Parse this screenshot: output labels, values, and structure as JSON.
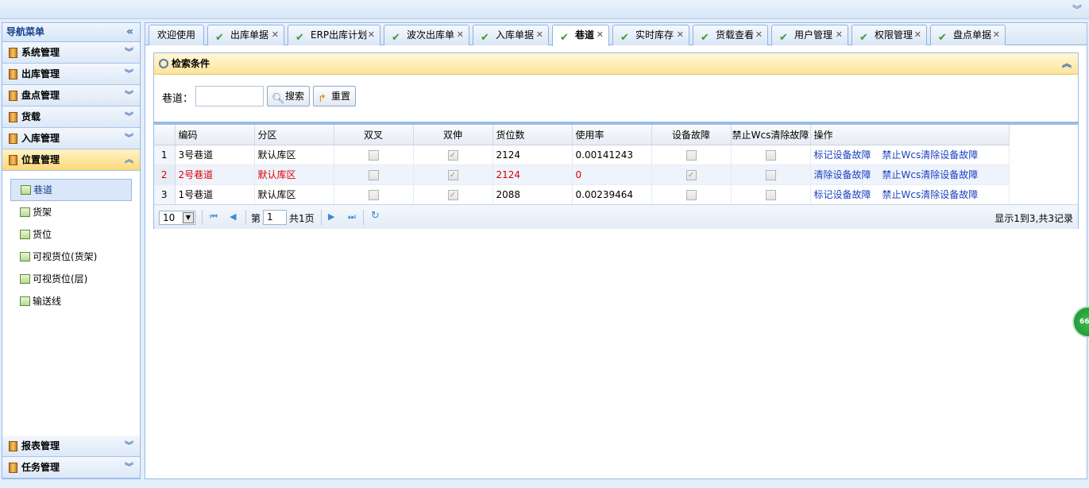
{
  "topbar": {
    "collapse_icon": "chevron-double-down-icon"
  },
  "nav": {
    "title": "导航菜单",
    "groups_top": [
      {
        "label": "系统管理"
      },
      {
        "label": "出库管理"
      },
      {
        "label": "盘点管理"
      },
      {
        "label": "货载"
      },
      {
        "label": "入库管理"
      },
      {
        "label": "位置管理",
        "active": true
      }
    ],
    "sub_items": [
      {
        "label": "巷道",
        "active": true
      },
      {
        "label": "货架"
      },
      {
        "label": "货位"
      },
      {
        "label": "可视货位(货架)"
      },
      {
        "label": "可视货位(层)"
      },
      {
        "label": "输送线"
      }
    ],
    "groups_bottom": [
      {
        "label": "报表管理"
      },
      {
        "label": "任务管理"
      }
    ]
  },
  "tabs": [
    {
      "label": "欢迎使用",
      "closable": false,
      "checked": false
    },
    {
      "label": "出库单据",
      "closable": true,
      "checked": true
    },
    {
      "label": "ERP出库计划",
      "closable": true,
      "checked": true
    },
    {
      "label": "波次出库单",
      "closable": true,
      "checked": true
    },
    {
      "label": "入库单据",
      "closable": true,
      "checked": true
    },
    {
      "label": "巷道",
      "closable": true,
      "checked": true,
      "active": true
    },
    {
      "label": "实时库存",
      "closable": true,
      "checked": true
    },
    {
      "label": "货载查看",
      "closable": true,
      "checked": true
    },
    {
      "label": "用户管理",
      "closable": true,
      "checked": true
    },
    {
      "label": "权限管理",
      "closable": true,
      "checked": true
    },
    {
      "label": "盘点单据",
      "closable": true,
      "checked": true
    }
  ],
  "search": {
    "title": "检索条件",
    "lane_label": "巷道：",
    "lane_value": "",
    "search_label": "搜索",
    "reset_label": "重置"
  },
  "grid": {
    "columns": [
      "编码",
      "分区",
      "双叉",
      "双伸",
      "货位数",
      "使用率",
      "设备故障",
      "禁止Wcs清除故障",
      "操作"
    ],
    "rows": [
      {
        "rownum": "1",
        "code": "3号巷道",
        "zone": "默认库区",
        "double_fork": false,
        "double_deep": true,
        "slots": "2124",
        "usage": "0.00141243",
        "fault": false,
        "wcs_block": false,
        "actions": [
          "标记设备故障",
          "禁止Wcs清除设备故障"
        ],
        "highlight": false
      },
      {
        "rownum": "2",
        "code": "2号巷道",
        "zone": "默认库区",
        "double_fork": false,
        "double_deep": true,
        "slots": "2124",
        "usage": "0",
        "fault": true,
        "wcs_block": false,
        "actions": [
          "清除设备故障",
          "禁止Wcs清除设备故障"
        ],
        "highlight": true
      },
      {
        "rownum": "3",
        "code": "1号巷道",
        "zone": "默认库区",
        "double_fork": false,
        "double_deep": true,
        "slots": "2088",
        "usage": "0.00239464",
        "fault": false,
        "wcs_block": false,
        "actions": [
          "标记设备故障",
          "禁止Wcs清除设备故障"
        ],
        "highlight": false
      }
    ]
  },
  "pager": {
    "page_size": "10",
    "page_prefix": "第",
    "page_number": "1",
    "page_suffix": "共1页",
    "info": "显示1到3,共3记录"
  },
  "bubble": {
    "text": "66"
  },
  "colors": {
    "accent": "#99bbe8",
    "highlight_text": "#dd0000",
    "link": "#1a3fbf",
    "check": "#3c9b2e"
  }
}
